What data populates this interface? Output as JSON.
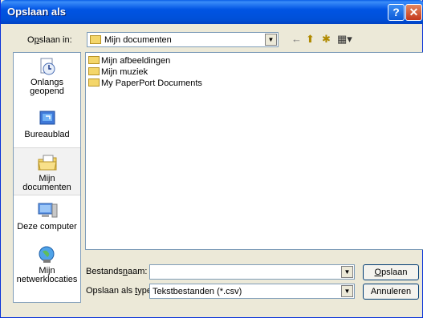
{
  "dialog": {
    "title": "Opslaan als",
    "help_glyph": "?",
    "close_glyph": "✕"
  },
  "lookin": {
    "label_pre": "O",
    "label_u": "p",
    "label_post": "slaan in:",
    "value": "Mijn documenten"
  },
  "toolbar": {
    "back_glyph": "←",
    "up_glyph": "⬆",
    "newfolder_glyph": "✱",
    "views_glyph": "▦▾"
  },
  "places": [
    {
      "label_1": "Onlangs",
      "label_2": "geopend",
      "icon": "recent-documents-icon"
    },
    {
      "label_1": "Bureaublad",
      "label_2": "",
      "icon": "desktop-icon"
    },
    {
      "label_1": "Mijn documenten",
      "label_2": "",
      "icon": "my-documents-icon"
    },
    {
      "label_1": "Deze computer",
      "label_2": "",
      "icon": "my-computer-icon"
    },
    {
      "label_1": "Mijn",
      "label_2": "netwerklocaties",
      "icon": "network-places-icon"
    }
  ],
  "files": [
    {
      "name": "Mijn afbeeldingen"
    },
    {
      "name": "Mijn muziek"
    },
    {
      "name": "My PaperPort Documents"
    }
  ],
  "filename": {
    "label_pre": "Bestands",
    "label_u": "n",
    "label_post": "aam:",
    "value": ""
  },
  "filetype": {
    "label_pre": "Opslaan als ",
    "label_u": "t",
    "label_post": "ype:",
    "value": "Tekstbestanden (*.csv)"
  },
  "buttons": {
    "save_u": "O",
    "save_post": "pslaan",
    "cancel": "Annuleren"
  }
}
